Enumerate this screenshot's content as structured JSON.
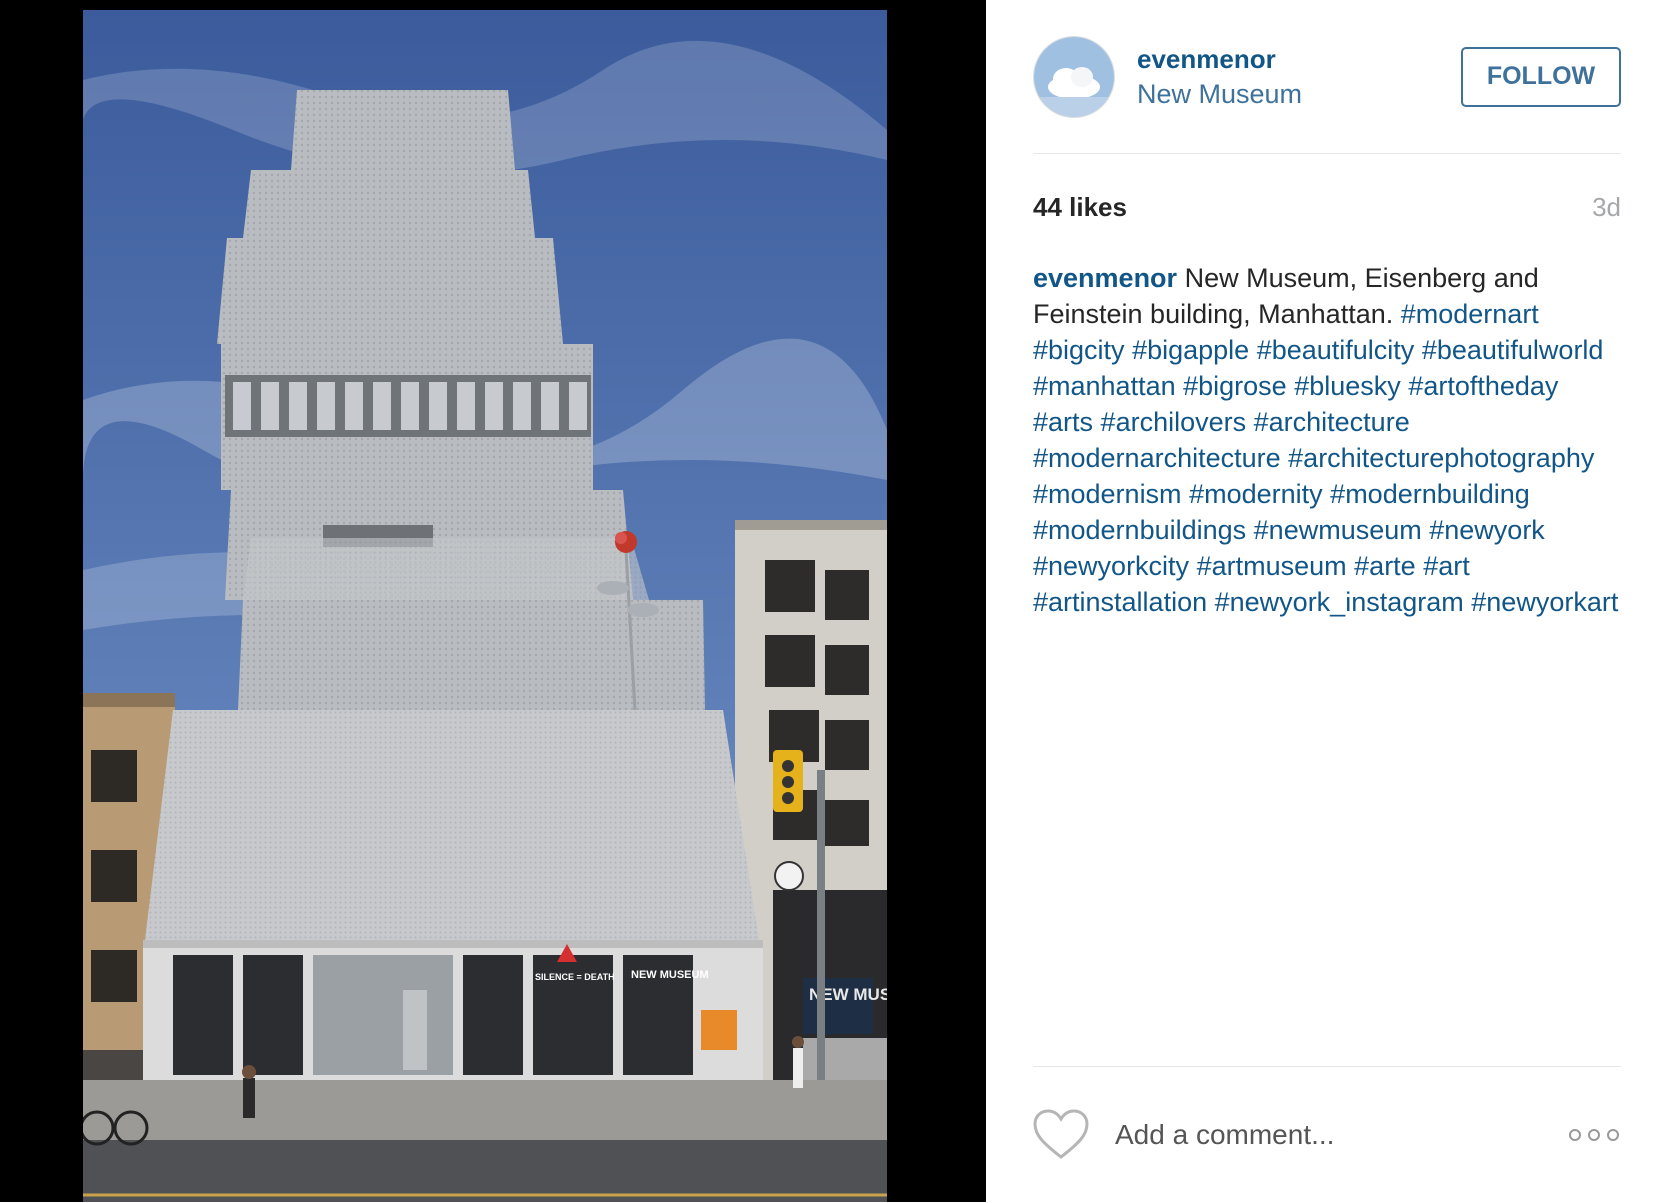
{
  "post": {
    "author": {
      "username": "evenmenor",
      "location": "New Museum"
    },
    "follow_label": "FOLLOW",
    "likes": "44 likes",
    "time_ago": "3d",
    "caption": {
      "author": "evenmenor",
      "text": " New Museum, Eisenberg and Feinstein building, Manhattan. ",
      "hashtags": [
        "#modernart",
        "#bigcity",
        "#bigapple",
        "#beautifulcity",
        "#beautifulworld",
        "#manhattan",
        "#bigrose",
        "#bluesky",
        "#artoftheday",
        "#arts",
        "#archilovers",
        "#architecture",
        "#modernarchitecture",
        "#architecturephotography",
        "#modernism",
        "#modernity",
        "#modernbuilding",
        "#modernbuildings",
        "#newmuseum",
        "#newyork",
        "#newyorkcity",
        "#artmuseum",
        "#arte",
        "#art",
        "#artinstallation",
        "#newyork_instagram",
        "#newyorkart"
      ]
    },
    "comment": {
      "placeholder": "Add a comment..."
    },
    "icons": {
      "like": "heart-icon",
      "more": "more-options-icon"
    },
    "photo_signage": {
      "banner": "SILENCE = DEATH",
      "museum_sign": "NEW MUSEUM",
      "street_sign": "NEW MUSEUM"
    },
    "colors": {
      "link": "#125688",
      "location": "#3f729b",
      "muted": "#a5a7aa"
    }
  }
}
